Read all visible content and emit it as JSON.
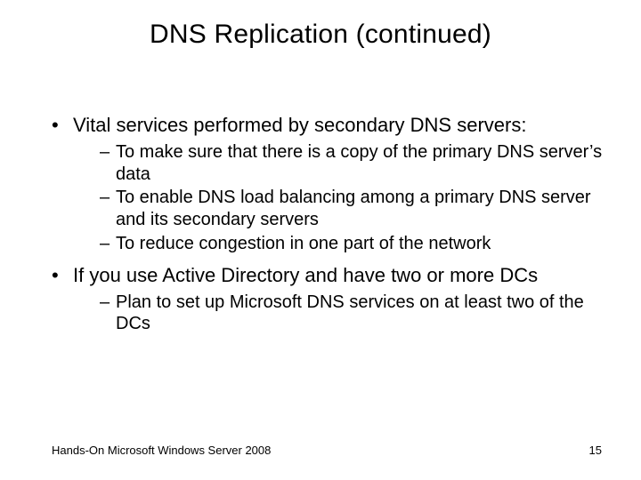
{
  "title": "DNS Replication (continued)",
  "bullets": [
    {
      "text": "Vital services performed by secondary DNS servers:",
      "sub": [
        "To make sure that there is a copy of the primary DNS server’s data",
        "To enable DNS load balancing among a primary DNS server and its secondary servers",
        "To reduce congestion in one part of the network"
      ]
    },
    {
      "text": "If you use Active Directory and have two or more DCs",
      "sub": [
        "Plan to set up Microsoft DNS services on at least two of the DCs"
      ]
    }
  ],
  "footer": {
    "source": "Hands-On Microsoft Windows Server 2008",
    "page": "15"
  }
}
